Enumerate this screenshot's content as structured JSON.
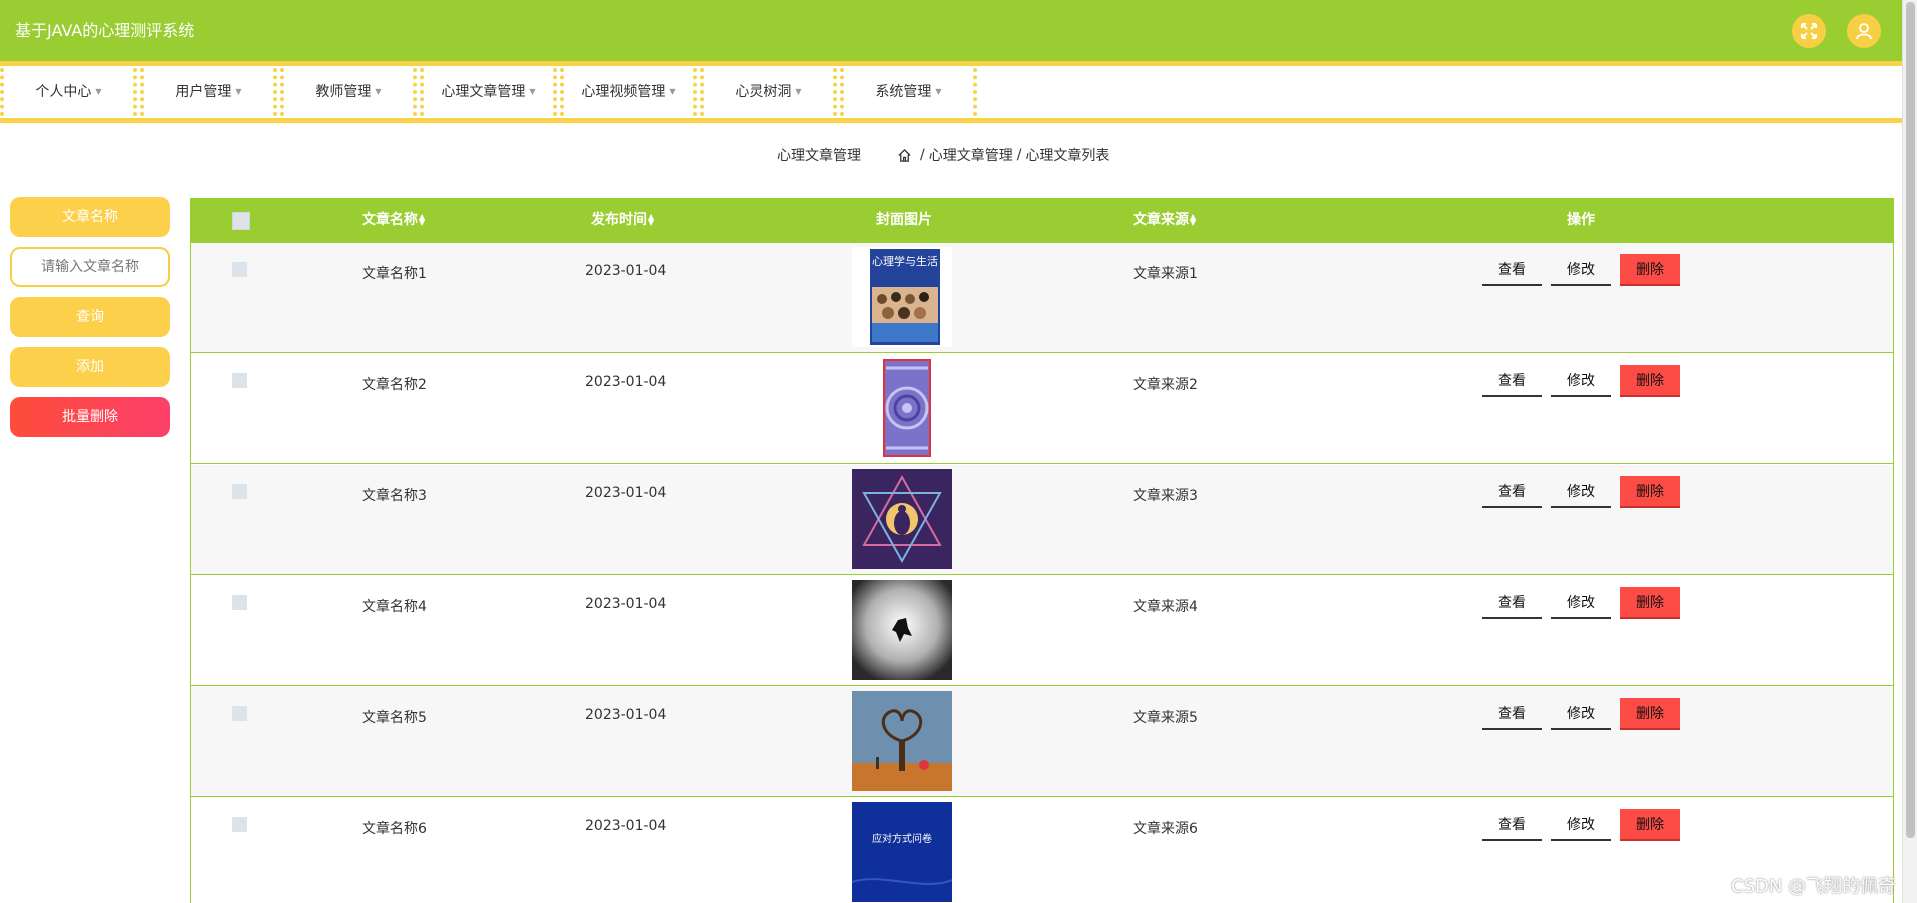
{
  "app": {
    "title": "基于JAVA的心理测评系统"
  },
  "header": {
    "fullscreen_icon": "fullscreen-icon",
    "user_icon": "user-icon"
  },
  "nav": {
    "items": [
      {
        "label": "个人中心"
      },
      {
        "label": "用户管理"
      },
      {
        "label": "教师管理"
      },
      {
        "label": "心理文章管理"
      },
      {
        "label": "心理视频管理"
      },
      {
        "label": "心灵树洞"
      },
      {
        "label": "系统管理"
      }
    ]
  },
  "breadcrumb": {
    "page_title": "心理文章管理",
    "home_icon": "home-icon",
    "items": [
      "心理文章管理",
      "心理文章列表"
    ],
    "separator": "/"
  },
  "search": {
    "field_label": "文章名称",
    "placeholder": "请输入文章名称",
    "query_label": "查询",
    "add_label": "添加",
    "batch_delete_label": "批量删除"
  },
  "table": {
    "columns": [
      "文章名称",
      "发布时间",
      "封面图片",
      "文章来源",
      "操作"
    ],
    "rows": [
      {
        "name": "文章名称1",
        "date": "2023-01-04",
        "source": "文章来源1",
        "cover_text": "心理学与生活"
      },
      {
        "name": "文章名称2",
        "date": "2023-01-04",
        "source": "文章来源2",
        "cover_text": ""
      },
      {
        "name": "文章名称3",
        "date": "2023-01-04",
        "source": "文章来源3",
        "cover_text": ""
      },
      {
        "name": "文章名称4",
        "date": "2023-01-04",
        "source": "文章来源4",
        "cover_text": ""
      },
      {
        "name": "文章名称5",
        "date": "2023-01-04",
        "source": "文章来源5",
        "cover_text": ""
      },
      {
        "name": "文章名称6",
        "date": "2023-01-04",
        "source": "文章来源6",
        "cover_text": "应对方式问卷"
      }
    ],
    "actions": {
      "view": "查看",
      "edit": "修改",
      "delete": "删除"
    }
  },
  "watermark": "CSDN @飞翔的佩奇",
  "colors": {
    "primary": "#9acd32",
    "accent": "#f6d348",
    "danger": "#fd4b45"
  }
}
